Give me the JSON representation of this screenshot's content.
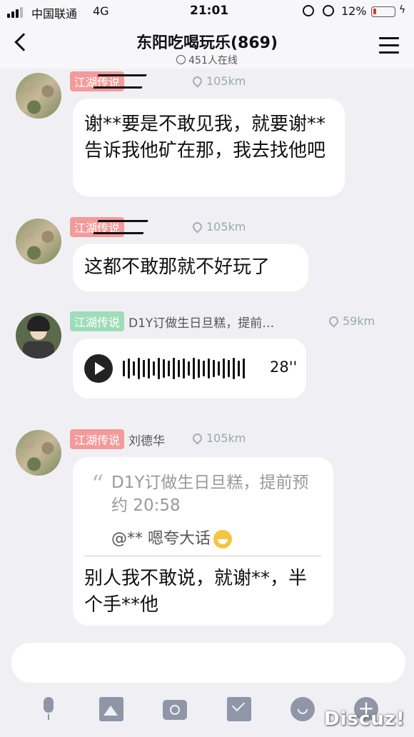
{
  "status_bar": {
    "carrier": "中国联通",
    "network": "4G",
    "time": "21:01",
    "battery_percent": "12%",
    "battery_level": 0.12,
    "accent_battery_low": "#e5322d"
  },
  "header": {
    "title": "东阳吃喝玩乐(869)",
    "online_count": "451人在线",
    "back_icon": "chevron-left-icon",
    "menu_icon": "hamburger-menu-icon"
  },
  "messages": [
    {
      "sender_badge": "江湖传说",
      "badge_color": "#f39a9a",
      "sender_name": "",
      "distance": "105km",
      "text": "谢**要是不敢见我，就要谢**告诉我他矿在那，我去找他吧"
    },
    {
      "sender_badge": "江湖传说",
      "badge_color": "#f39a9a",
      "sender_name": "",
      "distance": "105km",
      "text": "这都不敢那就不好玩了"
    },
    {
      "sender_badge": "江湖传说",
      "badge_color": "#9fdcb8",
      "sender_name": "D1Y订做生日旦糕，提前…",
      "distance": "59km",
      "voice_duration": "28''"
    },
    {
      "sender_badge": "江湖传说",
      "badge_color": "#f39a9a",
      "sender_name": "刘德华",
      "distance": "105km",
      "quoted_text": "D1Y订做生日旦糕，提前预约 20:58",
      "quoted_reply": "@** 嗯夸大话",
      "text": "别人我不敢说，就谢**，半个手**他"
    }
  ],
  "input": {
    "placeholder": ""
  },
  "toolbar": {
    "icons": [
      "microphone-icon",
      "image-icon",
      "camera-icon",
      "envelope-icon",
      "emoji-icon",
      "plus-icon"
    ]
  },
  "watermark": "Discuz!"
}
